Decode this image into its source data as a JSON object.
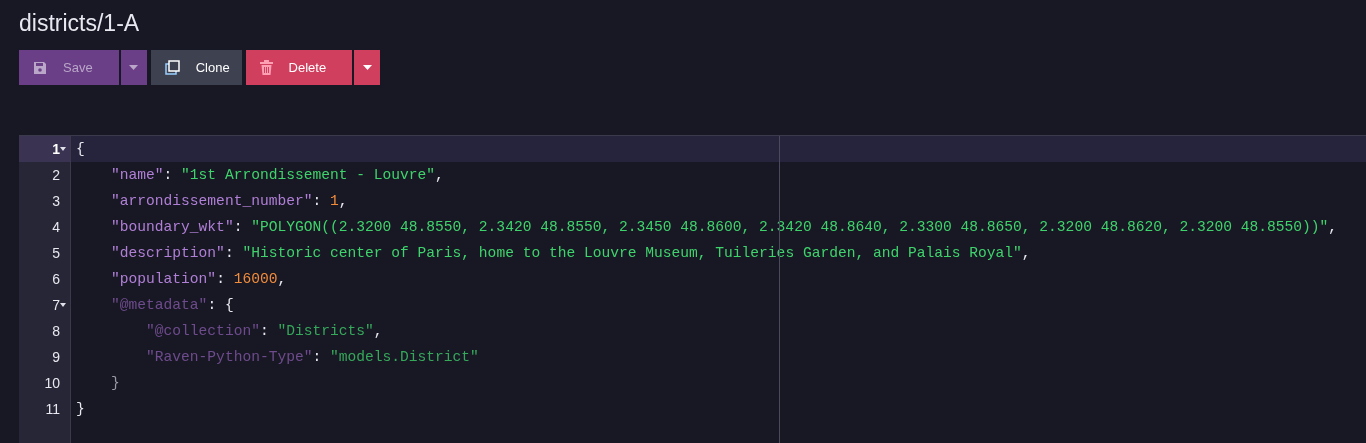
{
  "title": "districts/1-A",
  "toolbar": [
    {
      "kind": "save",
      "label": "Save",
      "disabled": true,
      "has_menu": true
    },
    {
      "kind": "clone",
      "label": "Clone",
      "disabled": false,
      "has_menu": false
    },
    {
      "kind": "delete",
      "label": "Delete",
      "disabled": false,
      "has_menu": true
    }
  ],
  "editor": {
    "lines": [
      {
        "number": "1",
        "foldable": true,
        "selected": true,
        "tokens": [
          {
            "kind": "punct",
            "text": "{"
          }
        ]
      },
      {
        "number": "2",
        "foldable": false,
        "selected": false,
        "tokens": [
          {
            "kind": "key",
            "text": "    \"name\""
          },
          {
            "kind": "punct",
            "text": ": "
          },
          {
            "kind": "string",
            "text": "\"1st Arrondissement - Louvre\""
          },
          {
            "kind": "punct",
            "text": ","
          }
        ]
      },
      {
        "number": "3",
        "foldable": false,
        "selected": false,
        "tokens": [
          {
            "kind": "key",
            "text": "    \"arrondissement_number\""
          },
          {
            "kind": "punct",
            "text": ": "
          },
          {
            "kind": "number",
            "text": "1"
          },
          {
            "kind": "punct",
            "text": ","
          }
        ]
      },
      {
        "number": "4",
        "foldable": false,
        "selected": false,
        "tokens": [
          {
            "kind": "key",
            "text": "    \"boundary_wkt\""
          },
          {
            "kind": "punct",
            "text": ": "
          },
          {
            "kind": "string",
            "text": "\"POLYGON((2.3200 48.8550, 2.3420 48.8550, 2.3450 48.8600, 2.3420 48.8640, 2.3300 48.8650, 2.3200 48.8620, 2.3200 48.8550))\""
          },
          {
            "kind": "punct",
            "text": ","
          }
        ]
      },
      {
        "number": "5",
        "foldable": false,
        "selected": false,
        "tokens": [
          {
            "kind": "key",
            "text": "    \"description\""
          },
          {
            "kind": "punct",
            "text": ": "
          },
          {
            "kind": "string",
            "text": "\"Historic center of Paris, home to the Louvre Museum, Tuileries Garden, and Palais Royal\""
          },
          {
            "kind": "punct",
            "text": ","
          }
        ]
      },
      {
        "number": "6",
        "foldable": false,
        "selected": false,
        "tokens": [
          {
            "kind": "key",
            "text": "    \"population\""
          },
          {
            "kind": "punct",
            "text": ": "
          },
          {
            "kind": "number",
            "text": "16000"
          },
          {
            "kind": "punct",
            "text": ","
          }
        ]
      },
      {
        "number": "7",
        "foldable": true,
        "selected": false,
        "tokens": [
          {
            "kind": "meta-key",
            "text": "    \"@metadata\""
          },
          {
            "kind": "punct",
            "text": ": {"
          }
        ]
      },
      {
        "number": "8",
        "foldable": false,
        "selected": false,
        "tokens": [
          {
            "kind": "meta-key",
            "text": "        \"@collection\""
          },
          {
            "kind": "punct",
            "text": ": "
          },
          {
            "kind": "meta-string",
            "text": "\"Districts\""
          },
          {
            "kind": "punct",
            "text": ","
          }
        ]
      },
      {
        "number": "9",
        "foldable": false,
        "selected": false,
        "tokens": [
          {
            "kind": "meta-key",
            "text": "        \"Raven-Python-Type\""
          },
          {
            "kind": "punct",
            "text": ": "
          },
          {
            "kind": "meta-string",
            "text": "\"models.District\""
          }
        ]
      },
      {
        "number": "10",
        "foldable": false,
        "selected": false,
        "tokens": [
          {
            "kind": "dim",
            "text": "    }"
          }
        ]
      },
      {
        "number": "11",
        "foldable": false,
        "selected": false,
        "tokens": [
          {
            "kind": "punct",
            "text": "}"
          }
        ]
      }
    ]
  }
}
